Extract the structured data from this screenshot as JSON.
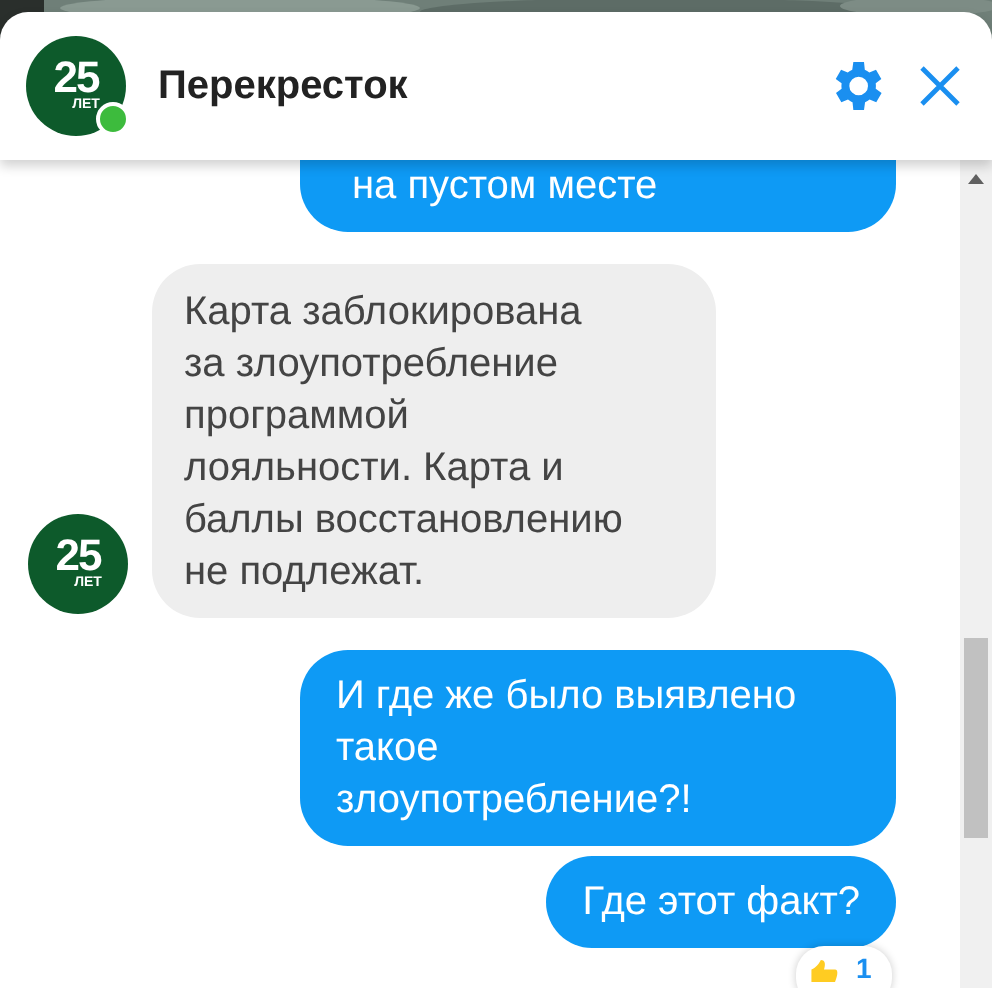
{
  "header": {
    "title": "Перекресток",
    "online": true,
    "logo": {
      "number": "25",
      "caption": "ЛЕТ"
    }
  },
  "messages": [
    {
      "kind": "outgoing",
      "clipped": true,
      "text": "на пустом месте"
    },
    {
      "kind": "incoming",
      "clipped": false,
      "avatar": {
        "number": "25",
        "caption": "ЛЕТ"
      },
      "text": "Карта заблокирована за злоупотребление программой лояльности. Карта и баллы восстановлению не подлежат."
    },
    {
      "kind": "outgoing",
      "clipped": false,
      "text": "И где же было выявлено такое злоупотребление?!"
    },
    {
      "kind": "outgoing",
      "clipped": false,
      "text": "Где этот факт?"
    }
  ],
  "reaction": {
    "count": "1"
  }
}
